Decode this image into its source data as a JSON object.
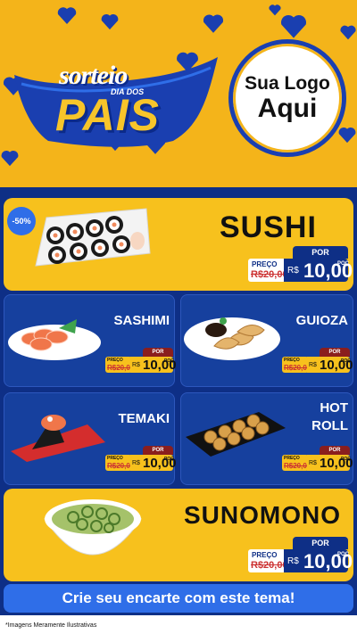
{
  "header": {
    "banner": {
      "line1": "sorteio",
      "line2": "DIA DOS",
      "line3": "PAIS"
    },
    "logo": {
      "line1": "Sua Logo",
      "line2": "Aqui"
    }
  },
  "items": {
    "sushi": {
      "name": "SUSHI",
      "badge": "-50%",
      "por": "POR",
      "preco_label": "PREÇO",
      "old_price": "R$20,00",
      "currency": "R$",
      "price": "10,00",
      "unit": "POÇ"
    },
    "sashimi": {
      "name": "SASHIMI",
      "por": "POR",
      "preco_label": "PREÇO",
      "old_price": "R$20,00",
      "currency": "R$",
      "price": "10,00",
      "unit": "POÇ"
    },
    "guioza": {
      "name": "GUIOZA",
      "por": "POR",
      "preco_label": "PREÇO",
      "old_price": "R$20,00",
      "currency": "R$",
      "price": "10,00",
      "unit": "POÇ"
    },
    "temaki": {
      "name": "TEMAKI",
      "por": "POR",
      "preco_label": "PREÇO",
      "old_price": "R$20,00",
      "currency": "R$",
      "price": "10,00",
      "unit": "POÇ"
    },
    "hotroll": {
      "name_line1": "HOT",
      "name_line2": "ROLL",
      "por": "POR",
      "preco_label": "PREÇO",
      "old_price": "R$20,00",
      "currency": "R$",
      "price": "10,00",
      "unit": "POÇ"
    },
    "sunomono": {
      "name": "SUNOMONO",
      "por": "POR",
      "preco_label": "PREÇO",
      "old_price": "R$20,00",
      "currency": "R$",
      "price": "10,00",
      "unit": "POÇ"
    }
  },
  "cta": {
    "label": "Crie seu encarte com este tema!"
  },
  "footer": {
    "note": "*Imagens Meramente Ilustrativas"
  },
  "colors": {
    "yellow": "#f7c11d",
    "navy": "#0e2f86",
    "blue": "#2f6ee8",
    "header_bg": "#f4b41a"
  }
}
